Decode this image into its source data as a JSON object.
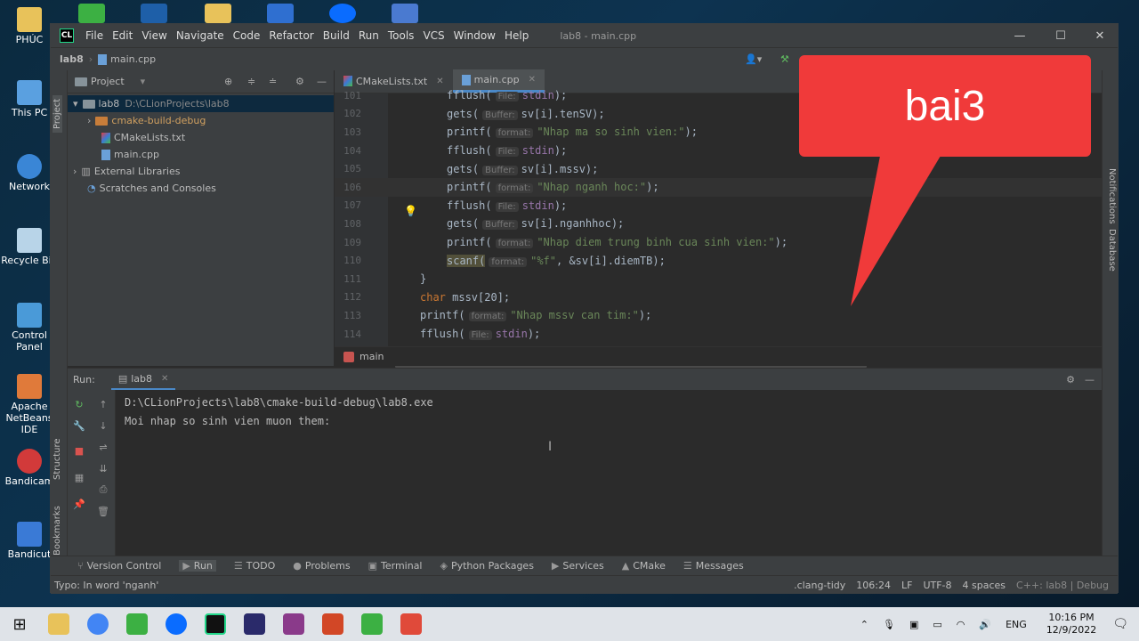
{
  "desktop": {
    "icons": [
      {
        "label": "PHÚC"
      },
      {
        "label": "This PC"
      },
      {
        "label": "Network"
      },
      {
        "label": "Recycle Bin"
      },
      {
        "label": "Control Panel"
      },
      {
        "label": "Apache NetBeans IDE"
      },
      {
        "label": "Bandicam"
      },
      {
        "label": "Bandicut"
      }
    ],
    "top_icons": [
      "clion-icon",
      "virtualbox-icon",
      "folder-icon",
      "app-icon",
      "zalo-icon",
      "app-icon"
    ]
  },
  "ide": {
    "logo": "CL",
    "menu": [
      "File",
      "Edit",
      "View",
      "Navigate",
      "Code",
      "Refactor",
      "Build",
      "Run",
      "Tools",
      "VCS",
      "Window",
      "Help"
    ],
    "window_title": "lab8 - main.cpp",
    "breadcrumb_project": "lab8",
    "breadcrumb_file": "main.cpp"
  },
  "project": {
    "header": "Project",
    "items": [
      {
        "label": "lab8",
        "path": "D:\\CLionProjects\\lab8"
      },
      {
        "label": "cmake-build-debug"
      },
      {
        "label": "CMakeLists.txt"
      },
      {
        "label": "main.cpp"
      },
      {
        "label": "External Libraries"
      },
      {
        "label": "Scratches and Consoles"
      }
    ]
  },
  "editor": {
    "tabs": [
      {
        "label": "CMakeLists.txt"
      },
      {
        "label": "main.cpp"
      }
    ],
    "lines": [
      {
        "n": "101",
        "a": "fflush(",
        "h": "File:",
        "b": "stdin);"
      },
      {
        "n": "102",
        "a": "gets(",
        "h": "Buffer:",
        "b": "sv[i].tenSV);"
      },
      {
        "n": "103",
        "a": "printf(",
        "h": "format:",
        "b": "\"Nhap ma so sinh vien:\");"
      },
      {
        "n": "104",
        "a": "fflush(",
        "h": "File:",
        "b": "stdin);"
      },
      {
        "n": "105",
        "a": "gets(",
        "h": "Buffer:",
        "b": "sv[i].mssv);"
      },
      {
        "n": "106",
        "a": "printf(",
        "h": "format:",
        "b": "\"Nhap nganh hoc:\");"
      },
      {
        "n": "107",
        "a": "fflush(",
        "h": "File:",
        "b": "stdin);"
      },
      {
        "n": "108",
        "a": "gets(",
        "h": "Buffer:",
        "b": "sv[i].nganhhoc);"
      },
      {
        "n": "109",
        "a": "printf(",
        "h": "format:",
        "b": "\"Nhap diem trung binh cua sinh vien:\");"
      },
      {
        "n": "110",
        "a": "scanf(",
        "h": "format:",
        "b": "\"%f\", &sv[i].diemTB);"
      },
      {
        "n": "111",
        "a": "}",
        "h": "",
        "b": ""
      },
      {
        "n": "112",
        "a": "char mssv[20];",
        "h": "",
        "b": ""
      },
      {
        "n": "113",
        "a": "printf(",
        "h": "format:",
        "b": "\"Nhap mssv can tim:\");"
      },
      {
        "n": "114",
        "a": "fflush(",
        "h": "File:",
        "b": "stdin);"
      }
    ],
    "crumb": "main"
  },
  "run": {
    "label": "Run:",
    "tab": "lab8",
    "output": [
      "D:\\CLionProjects\\lab8\\cmake-build-debug\\lab8.exe",
      "Moi nhap so sinh vien muon them:"
    ]
  },
  "bottom_tabs": [
    "Version Control",
    "Run",
    "TODO",
    "Problems",
    "Terminal",
    "Python Packages",
    "Services",
    "CMake",
    "Messages"
  ],
  "left_strip": [
    "Project",
    "Structure",
    "Bookmarks"
  ],
  "right_strip": [
    "Notifications",
    "Database"
  ],
  "status": {
    "message": "Typo: In word 'nganh'",
    "right": [
      ".clang-tidy",
      "106:24",
      "LF",
      "UTF-8",
      "4 spaces",
      "C++: lab8 | Debug"
    ]
  },
  "callout": {
    "text": "bai3",
    "color": "#f03a3a"
  },
  "taskbar": {
    "lang": "ENG",
    "time": "10:16 PM",
    "date": "12/9/2022"
  }
}
